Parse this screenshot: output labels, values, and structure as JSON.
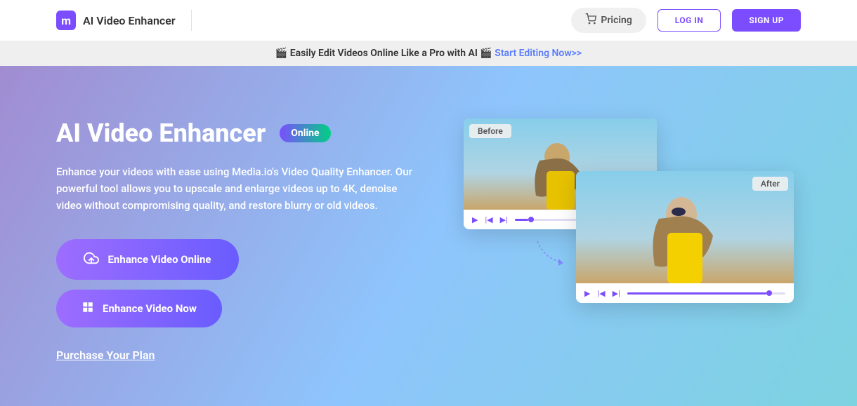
{
  "header": {
    "logo_text": "AI Video Enhancer",
    "pricing_label": "Pricing",
    "login_label": "LOG IN",
    "signup_label": "SIGN UP"
  },
  "announcement": {
    "text_prefix": "Easily Edit Videos Online Like a Pro with AI",
    "link_text": "Start Editing Now>>"
  },
  "hero": {
    "title": "AI Video Enhancer",
    "badge": "Online",
    "description": "Enhance your videos with ease using Media.io's Video Quality Enhancer. Our powerful tool allows you to upscale and enlarge videos up to 4K, denoise video without compromising quality, and restore blurry or old videos.",
    "cta_online": "Enhance Video Online",
    "cta_now": "Enhance Video Now",
    "purchase_link": "Purchase Your Plan",
    "before_label": "Before",
    "after_label": "After"
  }
}
